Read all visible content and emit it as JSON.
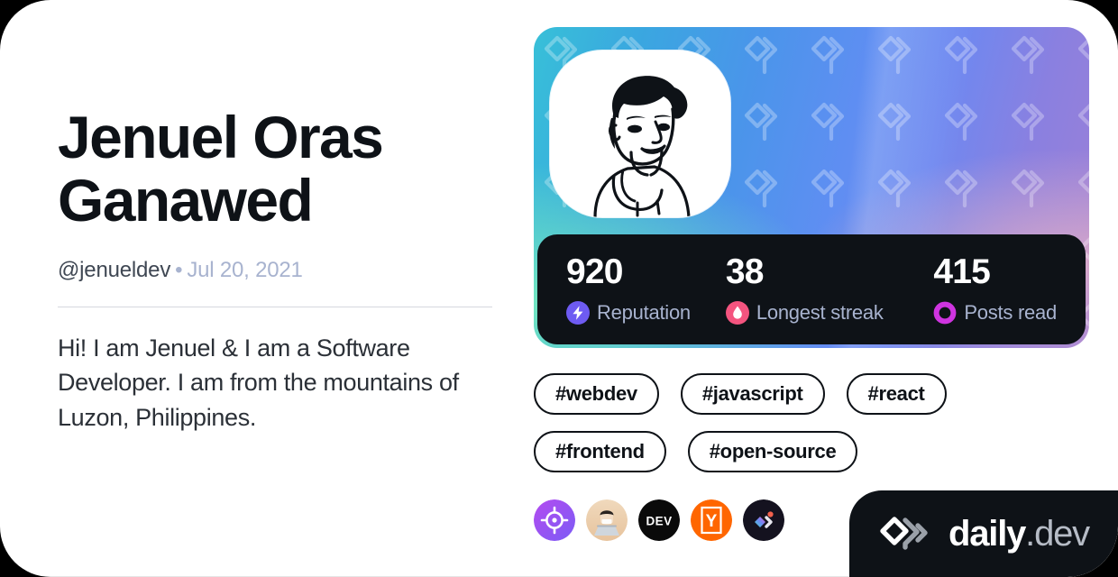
{
  "profile": {
    "name": "Jenuel Oras Ganawed",
    "handle": "@jenueldev",
    "separator": "•",
    "joined": "Jul 20, 2021",
    "bio": "Hi! I am Jenuel & I am a Software Developer. I am from the mountains of Luzon, Philippines.",
    "avatar_icon": "person-illustration-avatar"
  },
  "cover": {
    "watermark_icon": "daily-dev-logo-watermark",
    "gradient_from": "#38c0d8",
    "gradient_mid": "#5f8ef2",
    "gradient_to": "#9d7fd6",
    "accent_mint": "#78ebbe",
    "accent_pink": "#e2b0c8"
  },
  "stats": [
    {
      "value": "920",
      "label": "Reputation",
      "icon": "lightning-bolt-icon",
      "color": "#6e5bf2"
    },
    {
      "value": "38",
      "label": "Longest streak",
      "icon": "flame-icon",
      "color": "#f4547f"
    },
    {
      "value": "415",
      "label": "Posts read",
      "icon": "ring-icon",
      "color": "#cf34e0"
    }
  ],
  "tags": [
    {
      "label": "#webdev"
    },
    {
      "label": "#javascript"
    },
    {
      "label": "#react"
    },
    {
      "label": "#frontend"
    },
    {
      "label": "#open-source"
    }
  ],
  "socials": [
    {
      "name": "crosshair-target-icon"
    },
    {
      "name": "user-photo-avatar-icon"
    },
    {
      "name": "dev-to-icon",
      "text": "DEV"
    },
    {
      "name": "hacker-news-icon",
      "text": "Y"
    },
    {
      "name": "codepen-logo-icon"
    }
  ],
  "badge": {
    "logo_icon": "daily-dev-logo",
    "name_bold": "daily",
    "name_light": ".dev"
  },
  "theme": {
    "card_background": "#ffffff",
    "page_background": "#000000",
    "text_primary": "#0e1217",
    "text_secondary": "#3f4753",
    "text_muted": "#a8b3cf",
    "dark_surface": "#0e1217"
  }
}
